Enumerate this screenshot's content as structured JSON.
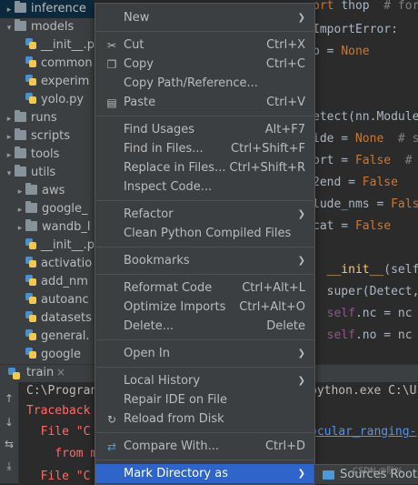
{
  "project_tree": {
    "items": [
      {
        "label": "inference",
        "kind": "folder",
        "expanded": false,
        "selected": true
      },
      {
        "label": "models",
        "kind": "folder",
        "expanded": true
      },
      {
        "label": "__init__.p",
        "kind": "py"
      },
      {
        "label": "common",
        "kind": "py"
      },
      {
        "label": "experim",
        "kind": "py"
      },
      {
        "label": "yolo.py",
        "kind": "py"
      },
      {
        "label": "runs",
        "kind": "folder",
        "expanded": false
      },
      {
        "label": "scripts",
        "kind": "folder",
        "expanded": false
      },
      {
        "label": "tools",
        "kind": "folder",
        "expanded": false
      },
      {
        "label": "utils",
        "kind": "folder",
        "expanded": true
      },
      {
        "label": "aws",
        "kind": "folder",
        "expanded": false
      },
      {
        "label": "google_",
        "kind": "folder",
        "expanded": false
      },
      {
        "label": "wandb_l",
        "kind": "folder",
        "expanded": false
      },
      {
        "label": "__init__.p",
        "kind": "py"
      },
      {
        "label": "activatio",
        "kind": "py"
      },
      {
        "label": "add_nm",
        "kind": "py"
      },
      {
        "label": "autoanc",
        "kind": "py"
      },
      {
        "label": "datasets",
        "kind": "py"
      },
      {
        "label": "general.",
        "kind": "py"
      },
      {
        "label": "google",
        "kind": "py"
      }
    ]
  },
  "editor": {
    "lines": [
      {
        "parts": [
          {
            "t": "ort ",
            "c": "kw"
          },
          {
            "t": "thop  ",
            "c": "cl"
          },
          {
            "t": "# for",
            "c": "cm"
          }
        ]
      },
      {
        "parts": [
          {
            "t": "ImportError:",
            "c": "cl"
          }
        ]
      },
      {
        "parts": [
          {
            "t": "p = ",
            "c": "cl"
          },
          {
            "t": "None",
            "c": "kw"
          }
        ]
      },
      {
        "parts": [
          {
            "t": "",
            "c": "cl"
          }
        ]
      },
      {
        "parts": [
          {
            "t": "",
            "c": "cl"
          }
        ]
      },
      {
        "parts": [
          {
            "t": "etect(nn.Module",
            "c": "cl"
          }
        ]
      },
      {
        "parts": [
          {
            "t": "ide = ",
            "c": "cl"
          },
          {
            "t": "None",
            "c": "kw"
          },
          {
            "t": "  # s",
            "c": "cm"
          }
        ]
      },
      {
        "parts": [
          {
            "t": "ort = ",
            "c": "cl"
          },
          {
            "t": "False",
            "c": "kw"
          },
          {
            "t": "  #",
            "c": "cm"
          }
        ]
      },
      {
        "parts": [
          {
            "t": "2end = ",
            "c": "cl"
          },
          {
            "t": "False",
            "c": "kw"
          }
        ]
      },
      {
        "parts": [
          {
            "t": "lude_nms = ",
            "c": "cl"
          },
          {
            "t": "Fals",
            "c": "kw"
          }
        ]
      },
      {
        "parts": [
          {
            "t": "cat = ",
            "c": "cl"
          },
          {
            "t": "False",
            "c": "kw"
          }
        ]
      },
      {
        "parts": [
          {
            "t": "",
            "c": "cl"
          }
        ]
      },
      {
        "parts": [
          {
            "t": "  __init__",
            "c": "fn"
          },
          {
            "t": "(self,",
            "c": "cl"
          }
        ]
      },
      {
        "parts": [
          {
            "t": "  super(Detect,",
            "c": "cl"
          }
        ]
      },
      {
        "parts": [
          {
            "t": "  self",
            "c": "sf"
          },
          {
            "t": ".nc = nc",
            "c": "cl"
          }
        ]
      },
      {
        "parts": [
          {
            "t": "  self",
            "c": "sf"
          },
          {
            "t": ".no = nc +",
            "c": "cl"
          }
        ]
      }
    ]
  },
  "run_panel": {
    "tab_label": "train",
    "close_glyph": "×",
    "console_lines": [
      {
        "text": "C:\\Progran",
        "color": "#bbbbbb"
      },
      {
        "text": "Traceback",
        "color": "#ff6b68"
      },
      {
        "text": "  File \"C",
        "color": "#ff6b68"
      },
      {
        "text": "    from m",
        "color": "#ff6b68"
      },
      {
        "text": "  File \"C",
        "color": "#ff6b68"
      }
    ],
    "console_right": [
      {
        "text": "python.exe C:\\U",
        "color": "#bbbbbb"
      },
      {
        "text": "ocular_ranging-",
        "color": "#5394ec"
      }
    ]
  },
  "context_menu": {
    "items": [
      {
        "label": "New",
        "shortcut": "",
        "submenu": true,
        "icon": ""
      },
      {
        "separator": true
      },
      {
        "label": "Cut",
        "shortcut": "Ctrl+X",
        "icon": "scissors-icon",
        "glyph": "✂"
      },
      {
        "label": "Copy",
        "shortcut": "Ctrl+C",
        "icon": "copy-icon",
        "glyph": "❐"
      },
      {
        "label": "Copy Path/Reference...",
        "shortcut": ""
      },
      {
        "label": "Paste",
        "shortcut": "Ctrl+V",
        "icon": "paste-icon",
        "glyph": "▤"
      },
      {
        "separator": true
      },
      {
        "label": "Find Usages",
        "shortcut": "Alt+F7"
      },
      {
        "label": "Find in Files...",
        "shortcut": "Ctrl+Shift+F"
      },
      {
        "label": "Replace in Files...",
        "shortcut": "Ctrl+Shift+R"
      },
      {
        "label": "Inspect Code...",
        "shortcut": ""
      },
      {
        "separator": true
      },
      {
        "label": "Refactor",
        "shortcut": "",
        "submenu": true
      },
      {
        "label": "Clean Python Compiled Files",
        "shortcut": ""
      },
      {
        "separator": true
      },
      {
        "label": "Bookmarks",
        "shortcut": "",
        "submenu": true
      },
      {
        "separator": true
      },
      {
        "label": "Reformat Code",
        "shortcut": "Ctrl+Alt+L"
      },
      {
        "label": "Optimize Imports",
        "shortcut": "Ctrl+Alt+O"
      },
      {
        "label": "Delete...",
        "shortcut": "Delete"
      },
      {
        "separator": true
      },
      {
        "label": "Open In",
        "shortcut": "",
        "submenu": true
      },
      {
        "separator": true
      },
      {
        "label": "Local History",
        "shortcut": "",
        "submenu": true
      },
      {
        "label": "Repair IDE on File",
        "shortcut": ""
      },
      {
        "label": "Reload from Disk",
        "shortcut": "",
        "icon": "reload-icon",
        "glyph": "↻"
      },
      {
        "separator": true
      },
      {
        "label": "Compare With...",
        "shortcut": "Ctrl+D",
        "icon": "compare-icon",
        "glyph": "⇄"
      },
      {
        "separator": true
      },
      {
        "label": "Mark Directory as",
        "shortcut": "",
        "submenu": true,
        "highlight": true
      }
    ]
  },
  "submenu": {
    "label": "Sources Root"
  },
  "watermark": "CSDN @阮%"
}
